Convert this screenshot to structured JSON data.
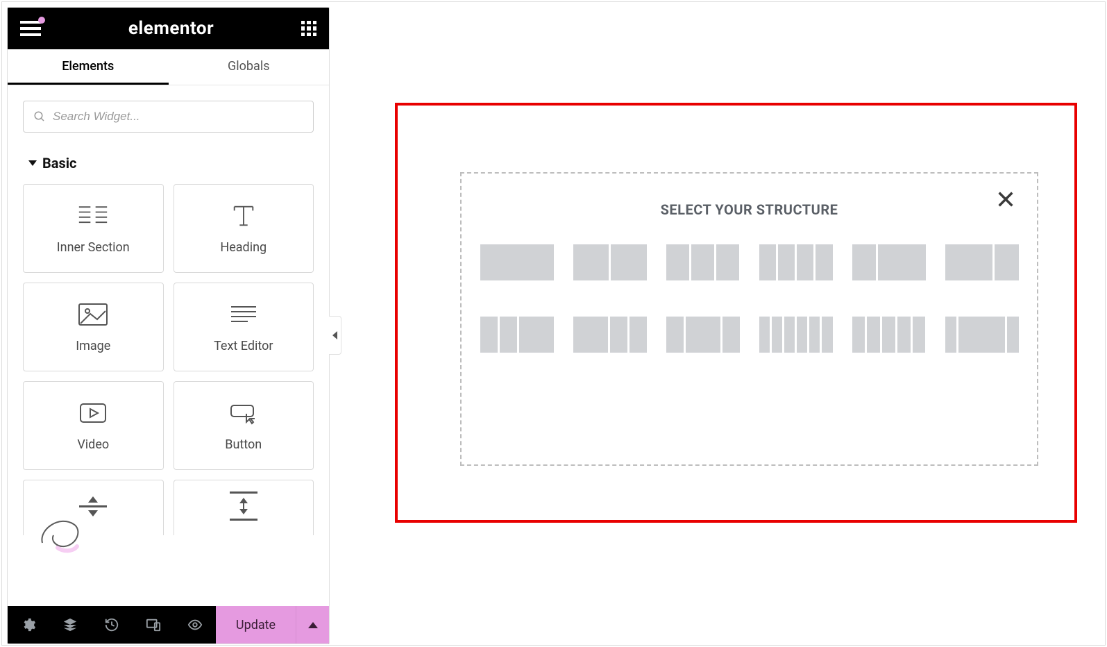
{
  "header": {
    "logo": "elementor"
  },
  "tabs": {
    "elements": "Elements",
    "globals": "Globals",
    "active": "elements"
  },
  "search": {
    "placeholder": "Search Widget..."
  },
  "section": {
    "basic": "Basic"
  },
  "widgets": {
    "inner_section": "Inner Section",
    "heading": "Heading",
    "image": "Image",
    "text_editor": "Text Editor",
    "video": "Video",
    "button": "Button",
    "divider": "Divider",
    "spacer": "Spacer"
  },
  "footer": {
    "update": "Update"
  },
  "structure": {
    "title": "SELECT YOUR STRUCTURE",
    "presets": [
      [
        100
      ],
      [
        50,
        50
      ],
      [
        33,
        33,
        33
      ],
      [
        25,
        25,
        25,
        25
      ],
      [
        33,
        66
      ],
      [
        66,
        33
      ],
      [
        25,
        25,
        50
      ],
      [
        50,
        25,
        25
      ],
      [
        25,
        50,
        25
      ],
      [
        16,
        16,
        16,
        16,
        16,
        16
      ],
      [
        20,
        20,
        20,
        20,
        20
      ],
      [
        16,
        66,
        16
      ]
    ]
  },
  "colors": {
    "accent": "#e59ae0",
    "highlight_border": "#e80000",
    "preset_fill": "#d0d2d5"
  }
}
